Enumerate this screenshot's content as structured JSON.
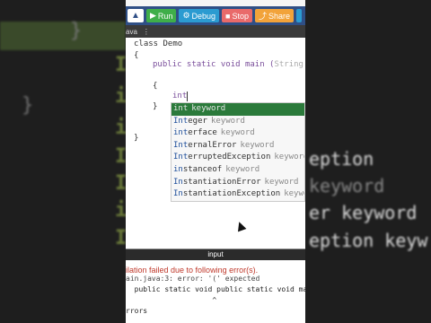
{
  "toolbar": {
    "run_label": "Run",
    "debug_label": "Debug",
    "stop_label": "Stop",
    "share_label": "Share"
  },
  "tabs": {
    "file_tab": "ava",
    "menu_glyph": "⋮"
  },
  "code": {
    "line1": "class Demo",
    "line2": "{",
    "line3_kw": "public static void main (",
    "line3_arg": "String[",
    "line4": "{",
    "line5_typed": "int",
    "line6": "}",
    "line7": "}"
  },
  "autocomplete": [
    {
      "match": "int",
      "rest": "",
      "kind": "keyword",
      "selected": true
    },
    {
      "match": "Int",
      "rest": "eger",
      "kind": "keyword",
      "selected": false
    },
    {
      "match": "int",
      "rest": "erface",
      "kind": "keyword",
      "selected": false
    },
    {
      "match": "Int",
      "rest": "ernalError",
      "kind": "keyword",
      "selected": false
    },
    {
      "match": "Int",
      "rest": "erruptedException",
      "kind": "keyword",
      "selected": false
    },
    {
      "match": "in",
      "rest": "stanceof",
      "kind": "keyword",
      "selected": false
    },
    {
      "match": "In",
      "rest": "stantiationError",
      "kind": "keyword",
      "selected": false
    },
    {
      "match": "In",
      "rest": "stantiationException",
      "kind": "keyword",
      "selected": false
    }
  ],
  "console": {
    "input_label": "input",
    "error_message": "ilation failed due to following error(s).",
    "out_line1": "ain.java:3: error: '(' expected",
    "out_line2": "  public static void public static void main (S",
    "out_line3": "                    ^",
    "out_line4": "rrors"
  },
  "background": {
    "bg_word1": "eption",
    "bg_word2": "keyword",
    "bg_word3": "er  keyword",
    "bg_word4": "eption  keyw",
    "bg_kw": "keyword"
  },
  "colors": {
    "toolbar": "#2f4f86",
    "run": "#3fae49",
    "debug": "#2b9bd1",
    "stop": "#e96a6a",
    "share": "#f2a33a",
    "selected_suggestion": "#2b7a3b",
    "error_text": "#c0392b"
  }
}
